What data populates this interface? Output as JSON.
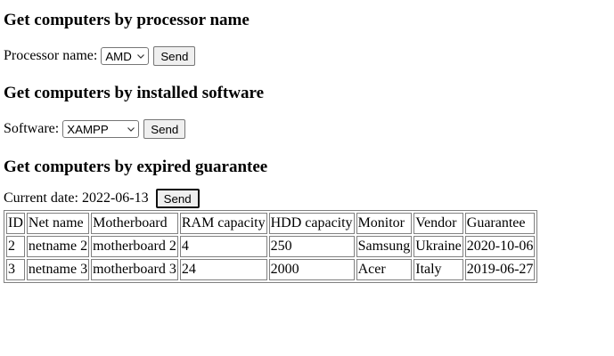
{
  "sections": {
    "processor": {
      "title": "Get computers by processor name",
      "label": "Processor name:",
      "selected": "AMD",
      "button": "Send"
    },
    "software": {
      "title": "Get computers by installed software",
      "label": "Software:",
      "selected": "XAMPP",
      "button": "Send"
    },
    "guarantee": {
      "title": "Get computers by expired guarantee",
      "label": "Current date: 2022-06-13",
      "button": "Send"
    }
  },
  "table": {
    "headers": [
      "ID",
      "Net name",
      "Motherboard",
      "RAM capacity",
      "HDD capacity",
      "Monitor",
      "Vendor",
      "Guarantee"
    ],
    "rows": [
      [
        "2",
        "netname 2",
        "motherboard 2",
        "4",
        "250",
        "Samsung",
        "Ukraine",
        "2020-10-06"
      ],
      [
        "3",
        "netname 3",
        "motherboard 3",
        "24",
        "2000",
        "Acer",
        "Italy",
        "2019-06-27"
      ]
    ]
  },
  "icons": {
    "select_arrow": "chevron-down-icon"
  },
  "colors": {
    "button_bg": "#efefef",
    "border": "#808080"
  }
}
